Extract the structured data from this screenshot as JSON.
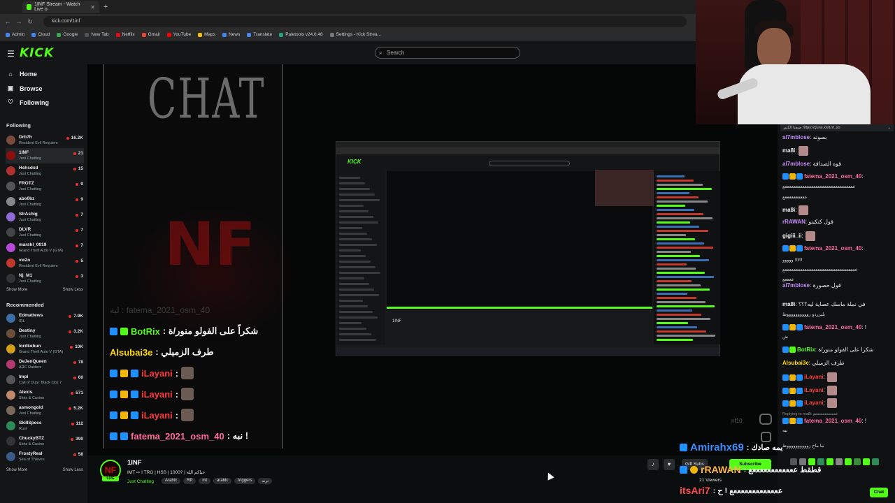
{
  "browser": {
    "tab_title": "1INF Stream - Watch Live o",
    "new_tab_glyph": "+",
    "url": "kick.com/1inf",
    "bookmarks": [
      {
        "label": "Admin",
        "color": "#4285f4"
      },
      {
        "label": "Cloud",
        "color": "#4285f4"
      },
      {
        "label": "Google",
        "color": "#34a853"
      },
      {
        "label": "New Tab",
        "color": "#555555"
      },
      {
        "label": "Netflix",
        "color": "#e50914"
      },
      {
        "label": "Gmail",
        "color": "#ea4335"
      },
      {
        "label": "YouTube",
        "color": "#ff0000"
      },
      {
        "label": "Maps",
        "color": "#fbbc05"
      },
      {
        "label": "News",
        "color": "#4285f4"
      },
      {
        "label": "Translate",
        "color": "#4285f4"
      },
      {
        "label": "Paletools v24.0.48",
        "color": "#1fa37a"
      },
      {
        "label": "Settings - Kick Strea...",
        "color": "#777777"
      }
    ]
  },
  "header": {
    "logo": "KICK",
    "search_placeholder": "Search"
  },
  "sidebar": {
    "nav": [
      {
        "label": "Home",
        "icon": "home-icon",
        "glyph": "⌂"
      },
      {
        "label": "Browse",
        "icon": "browse-icon",
        "glyph": "▣"
      },
      {
        "label": "Following",
        "icon": "heart-icon",
        "glyph": "♡"
      }
    ],
    "following_title": "Following",
    "following": [
      {
        "name": "Drb7h",
        "category": "Resident Evil Requiem",
        "viewers": "16.2K",
        "color": "#7a4b3a"
      },
      {
        "name": "1INF",
        "category": "Just Chatting",
        "viewers": "21",
        "color": "#8b0f0f"
      },
      {
        "name": "Hshsdxd",
        "category": "Just Chatting",
        "viewers": "15",
        "color": "#b03030"
      },
      {
        "name": "FROTZ",
        "category": "Just Chatting",
        "viewers": "9",
        "color": "#555555"
      },
      {
        "name": "abo0bz",
        "category": "Just Chatting",
        "viewers": "9",
        "color": "#888888"
      },
      {
        "name": "SIrAshig",
        "category": "Just Chatting",
        "viewers": "7",
        "color": "#8e6bd6"
      },
      {
        "name": "DLVR",
        "category": "Just Chatting",
        "viewers": "7",
        "color": "#444444"
      },
      {
        "name": "marshl_0019",
        "category": "Grand Theft Auto V (GTA)",
        "viewers": "7",
        "color": "#b54ad6"
      },
      {
        "name": "xw2o",
        "category": "Resident Evil Requiem",
        "viewers": "5",
        "color": "#c0392b"
      },
      {
        "name": "Nj_M1",
        "category": "Just Chatting",
        "viewers": "3",
        "color": "#333333"
      }
    ],
    "show_more": "Show More",
    "show_less": "Show Less",
    "recommended_title": "Recommended",
    "recommended": [
      {
        "name": "Edmattews",
        "category": "IRL",
        "viewers": "7.9K",
        "color": "#3a6ea5"
      },
      {
        "name": "Destiny",
        "category": "Just Chatting",
        "viewers": "3.2K",
        "color": "#6b4f3a"
      },
      {
        "name": "lordkebun",
        "category": "Grand Theft Auto V (GTA)",
        "viewers": "10K",
        "color": "#d4a017"
      },
      {
        "name": "DeJenQueen",
        "category": "ARC Raiders",
        "viewers": "78",
        "color": "#b33a6e"
      },
      {
        "name": "Impi",
        "category": "Call of Duty: Black Ops 7",
        "viewers": "60",
        "color": "#555555"
      },
      {
        "name": "Alexis",
        "category": "Slots & Casino",
        "viewers": "571",
        "color": "#c08a6a"
      },
      {
        "name": "asmongold",
        "category": "Just Chatting",
        "viewers": "5.2K",
        "color": "#7a6a5a"
      },
      {
        "name": "SkillSpecs",
        "category": "Rust",
        "viewers": "112",
        "color": "#2e8b57"
      },
      {
        "name": "ChuckyBTZ",
        "category": "Slots & Casino",
        "viewers": "390",
        "color": "#333333"
      },
      {
        "name": "FrostyReal",
        "category": "Sea of Thieves",
        "viewers": "58",
        "color": "#3a5a8a"
      }
    ]
  },
  "stream_overlay": {
    "chat_word": "CHAT",
    "nf_logo": "NF",
    "ghost_line": "لبه : fatema_2021_osm_40",
    "lines": [
      {
        "user": "BotRix",
        "msg": ": شكراً على الفولو منور/ة",
        "user_color": "#53fc18",
        "badges": [
          "#1e90ff",
          "#53fc18"
        ],
        "face": false
      },
      {
        "user": "Alsubai3e",
        "msg": ": طرف الزميلي",
        "user_color": "#ffd700",
        "badges": [],
        "face": false
      },
      {
        "user": "iLayani",
        "msg": ":",
        "user_color": "#ff3b3b",
        "badges": [
          "#1e90ff",
          "#f2b705",
          "#1e90ff"
        ],
        "face": true
      },
      {
        "user": "iLayani",
        "msg": ":",
        "user_color": "#ff3b3b",
        "badges": [
          "#1e90ff",
          "#f2b705",
          "#1e90ff"
        ],
        "face": true
      },
      {
        "user": "iLayani",
        "msg": ":",
        "user_color": "#ff3b3b",
        "badges": [
          "#1e90ff",
          "#f2b705",
          "#1e90ff"
        ],
        "face": true
      },
      {
        "user": "fatema_2021_osm_40",
        "msg": ": نبه !",
        "user_color": "#ff6b9a",
        "badges": [
          "#1e90ff",
          "#1e90ff"
        ],
        "face": false
      }
    ]
  },
  "chat": {
    "pinned": "ضيفنا الكبير https://guns.lol/1nf_so",
    "messages": [
      {
        "user": "al7mblose",
        "msg": ": بصوته",
        "color": "#c58af9",
        "badges": []
      },
      {
        "user": "ma8i",
        "msg": ":",
        "color": "#f5f5f5",
        "badges": [],
        "thumb": true
      },
      {
        "user": "al7mblose",
        "msg": ": قوه الصداقة",
        "color": "#c58af9",
        "badges": []
      },
      {
        "user": "fatema_2021_osm_40",
        "msg": ":",
        "color": "#ff6b9a",
        "badges": [
          "#1e90ff",
          "#f2b705",
          "#1e90ff"
        ]
      },
      {
        "user": "ma8i",
        "msg": ":",
        "color": "#f5f5f5",
        "badges": [],
        "thumb": true
      },
      {
        "user": "rRAWAN",
        "msg": ": قول كتكيتو",
        "color": "#c58af9",
        "badges": []
      },
      {
        "user": "gigiii_ii",
        "msg": ":",
        "color": "#f5f5f5",
        "badges": [],
        "thumb": true
      },
      {
        "user": "fatema_2021_osm_40",
        "msg": ":",
        "color": "#ff6b9a",
        "badges": [
          "#1e90ff",
          "#f2b705",
          "#1e90ff"
        ]
      },
      {
        "user": "al7mblose",
        "msg": ": قول حصورة",
        "color": "#c58af9",
        "badges": []
      },
      {
        "user": "ma8i",
        "msg": ": في نملة ماسك عصاية ليه؟؟؟",
        "color": "#f5f5f5",
        "badges": []
      },
      {
        "user": "fatema_2021_osm_40",
        "msg": ": !",
        "color": "#ff6b9a",
        "badges": [
          "#1e90ff",
          "#f2b705",
          "#1e90ff"
        ]
      },
      {
        "user": "BotRix",
        "msg": ": شكراً على الفولو منور/ة",
        "color": "#53fc18",
        "badges": [
          "#1e90ff",
          "#53fc18"
        ]
      },
      {
        "user": "Alsubai3e",
        "msg": ": طرف الزميلي",
        "color": "#ffd700",
        "badges": []
      },
      {
        "user": "iLayani",
        "msg": ":",
        "color": "#ff3b3b",
        "badges": [
          "#1e90ff",
          "#f2b705",
          "#1e90ff"
        ],
        "thumb": true
      },
      {
        "user": "iLayani",
        "msg": ":",
        "color": "#ff3b3b",
        "badges": [
          "#1e90ff",
          "#f2b705",
          "#1e90ff"
        ],
        "thumb": true
      },
      {
        "user": "iLayani",
        "msg": ":",
        "color": "#ff3b3b",
        "badges": [
          "#1e90ff",
          "#f2b705",
          "#1e90ff"
        ],
        "thumb": true
      },
      {
        "user": "fatema_2021_osm_40",
        "msg": ": !",
        "color": "#ff6b9a",
        "badges": [
          "#1e90ff",
          "#f2b705",
          "#1e90ff"
        ]
      }
    ],
    "wraps": [
      "ععععععععععععععععععععععععععععععععع",
      "ععععععععععع",
      "لالالا ووووو",
      "عععععععععععععععععععععععععععععععععع",
      "ععععع",
      "بليزردو زووووووووووط",
      "ش",
      "نبه",
      "Replying to ma8i: ععععععععععععع",
      "ما ماح زووووووووووط"
    ]
  },
  "float_overlay": {
    "line1_user": "Amirahx69",
    "line1_msg": ": يمه صادك",
    "line2_user": "rRAWAN",
    "line2_msg": ": قطقط ععععععععععععع",
    "line3_user": "itsAri7",
    "line3_msg": ": عععععععععععععع ! ح",
    "ghost_handle": "nf10",
    "viewers": "21 Viewers"
  },
  "stream_info": {
    "avatar_text": "NF",
    "live": "LIVE",
    "streamer": "1INF",
    "title": "IMT ⇨ I TRG | HSS | 1000? | حياكم الله",
    "category": "Just Chatting",
    "tags": [
      "Arabic",
      "RP",
      "mt",
      "arabic",
      "triggers",
      "ترند"
    ],
    "gift_subs": "Gift Subs",
    "subscribe": "Subscribe",
    "chat_button": "Chat"
  }
}
